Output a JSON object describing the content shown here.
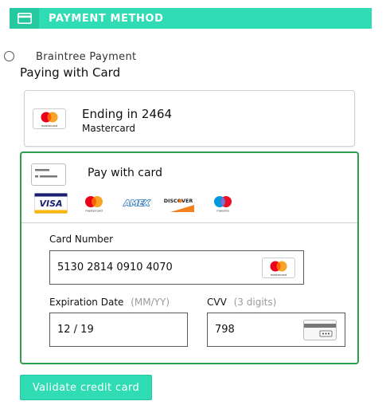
{
  "header": {
    "title": "PAYMENT METHOD",
    "icon": "credit-card-icon",
    "colors": {
      "bar": "#2fdcb4",
      "icon_box": "#24c9a1"
    }
  },
  "payment_option": {
    "label": "Braintree Payment",
    "selected": false
  },
  "paying_with": "Paying with Card",
  "saved_card": {
    "ending": "Ending in 2464",
    "brand": "Mastercard",
    "logo_text": "mastercard"
  },
  "new_card": {
    "title": "Pay with card",
    "accepted_brands": [
      {
        "name": "VISA",
        "icon": "visa-icon"
      },
      {
        "name": "mastercard",
        "icon": "mastercard-icon"
      },
      {
        "name": "AMEX",
        "icon": "amex-icon"
      },
      {
        "name": "DISCOVER",
        "icon": "discover-icon"
      },
      {
        "name": "maestro",
        "icon": "maestro-icon"
      }
    ],
    "card_number": {
      "label": "Card Number",
      "value": "5130 2814 0910 4070",
      "detected_brand_text": "mastercard"
    },
    "expiration": {
      "label": "Expiration Date",
      "hint": "(MM/YY)",
      "value": "12 / 19"
    },
    "cvv": {
      "label": "CVV",
      "hint": "(3 digits)",
      "value": "798"
    },
    "border_color": "#2e9e4f"
  },
  "actions": {
    "validate_label": "Validate credit card",
    "color": "#2fdcb4"
  }
}
